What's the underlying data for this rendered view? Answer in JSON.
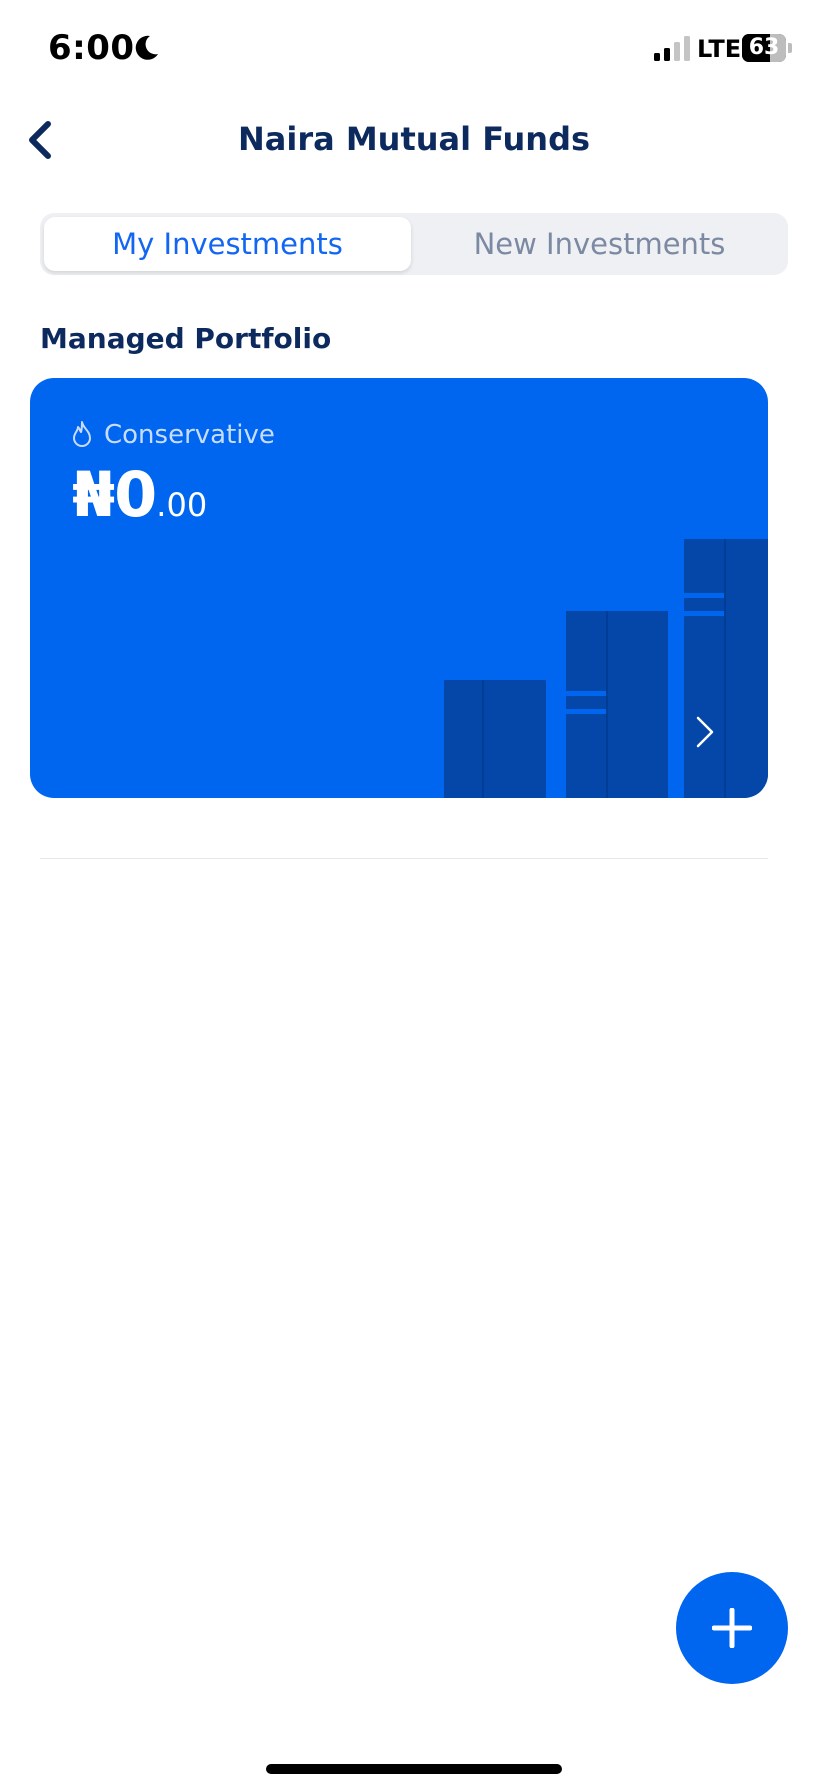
{
  "status_bar": {
    "time": "6:00",
    "network": "LTE",
    "battery_level": "63",
    "battery_fraction": 0.63
  },
  "header": {
    "title": "Naira Mutual Funds",
    "back_icon": "chevron-left-icon"
  },
  "tabs": [
    {
      "label": "My Investments",
      "active": true
    },
    {
      "label": "New Investments",
      "active": false
    }
  ],
  "section": {
    "title": "Managed Portfolio"
  },
  "portfolio_card": {
    "risk_icon": "flame-icon",
    "risk_label": "Conservative",
    "amount_main": "₦0",
    "amount_decimal": ".00",
    "chevron_icon": "chevron-right-icon"
  },
  "fab": {
    "icon": "plus-icon"
  },
  "colors": {
    "primary": "#0066f0",
    "title_navy": "#0d2a5e",
    "active_tab_text": "#1366f2",
    "inactive_tab_text": "#7b8aa2",
    "card_bar": "#0447a8"
  }
}
